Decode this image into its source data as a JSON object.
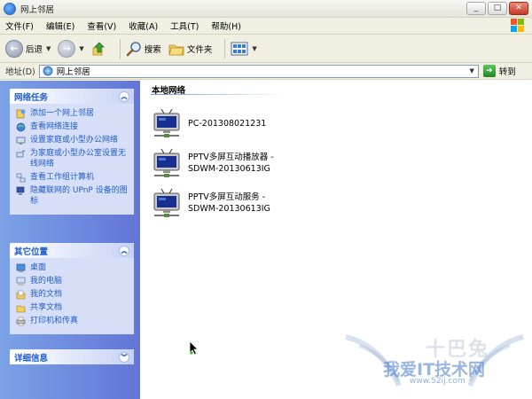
{
  "window": {
    "title": "网上邻居",
    "controls": [
      "_",
      "□",
      "✕"
    ]
  },
  "menu": [
    "文件(F)",
    "编辑(E)",
    "查看(V)",
    "收藏(A)",
    "工具(T)",
    "帮助(H)"
  ],
  "toolbar": {
    "back_label": "后退",
    "search_label": "搜索",
    "folders_label": "文件夹"
  },
  "address": {
    "label": "地址(D)",
    "value": "网上邻居",
    "go_label": "转到"
  },
  "tasks_panel": {
    "title": "网络任务",
    "items": [
      {
        "label": "添加一个网上邻居",
        "icon": "add-network-place-icon"
      },
      {
        "label": "查看网络连接",
        "icon": "network-connections-icon"
      },
      {
        "label": "设置家庭或小型办公网络",
        "icon": "home-network-icon"
      },
      {
        "label": "为家庭或小型办公室设置无线网络",
        "icon": "wireless-network-icon"
      },
      {
        "label": "查看工作组计算机",
        "icon": "workgroup-icon"
      },
      {
        "label": "隐藏联网的 UPnP 设备的图标",
        "icon": "upnp-icon"
      }
    ]
  },
  "places_panel": {
    "title": "其它位置",
    "items": [
      {
        "label": "桌面",
        "icon": "desktop-icon"
      },
      {
        "label": "我的电脑",
        "icon": "my-computer-icon"
      },
      {
        "label": "我的文档",
        "icon": "my-documents-icon"
      },
      {
        "label": "共享文档",
        "icon": "shared-documents-icon"
      },
      {
        "label": "打印机和传真",
        "icon": "printers-icon"
      }
    ]
  },
  "details_panel": {
    "title": "详细信息"
  },
  "content": {
    "group_title": "本地网络",
    "items": [
      {
        "line1": "PC-201308021231",
        "line2": ""
      },
      {
        "line1": "PPTV多屏互动播放器 -",
        "line2": "SDWM-20130613IG"
      },
      {
        "line1": "PPTV多屏互动服务 -",
        "line2": "SDWM-20130613IG"
      }
    ]
  },
  "watermark": {
    "main": "我爱IT技术网",
    "url": "www.52ij.com",
    "top": "十巴兔"
  }
}
